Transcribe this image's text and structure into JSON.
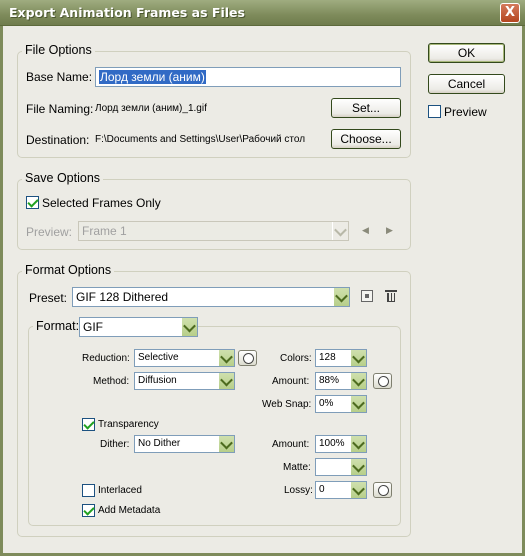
{
  "window": {
    "title": "Export Animation Frames as Files",
    "close_glyph": "X"
  },
  "buttons": {
    "ok": "OK",
    "cancel": "Cancel"
  },
  "preview_check": {
    "label": "Preview",
    "checked": false
  },
  "file_options": {
    "legend": "File Options",
    "base_name_label": "Base Name:",
    "base_name_value": "Лорд земли (аним)",
    "file_naming_label": "File Naming:",
    "file_naming_value": "Лорд земли (аним)_1.gif",
    "set_button": "Set...",
    "destination_label": "Destination:",
    "destination_value": "F:\\Documents and Settings\\User\\Рабочий стол",
    "choose_button": "Choose..."
  },
  "save_options": {
    "legend": "Save Options",
    "selected_frames_label": "Selected Frames Only",
    "selected_frames_checked": true,
    "preview_label": "Preview:",
    "preview_value": "Frame 1",
    "prev_icon": "◀",
    "next_icon": "▶"
  },
  "format_options": {
    "legend": "Format Options",
    "preset_label": "Preset:",
    "preset_value": "GIF 128 Dithered",
    "format_label": "Format:",
    "format_value": "GIF",
    "reduction_label": "Reduction:",
    "reduction_value": "Selective",
    "method_label": "Method:",
    "method_value": "Diffusion",
    "colors_label": "Colors:",
    "colors_value": "128",
    "amount_label": "Amount:",
    "amount_value": "88%",
    "web_snap_label": "Web Snap:",
    "web_snap_value": "0%",
    "transparency_label": "Transparency",
    "transparency_checked": true,
    "dither_label": "Dither:",
    "dither_value": "No Dither",
    "amount2_label": "Amount:",
    "amount2_value": "100%",
    "matte_label": "Matte:",
    "matte_value": "",
    "interlaced_label": "Interlaced",
    "interlaced_checked": false,
    "lossy_label": "Lossy:",
    "lossy_value": "0",
    "add_metadata_label": "Add Metadata",
    "add_metadata_checked": true
  }
}
